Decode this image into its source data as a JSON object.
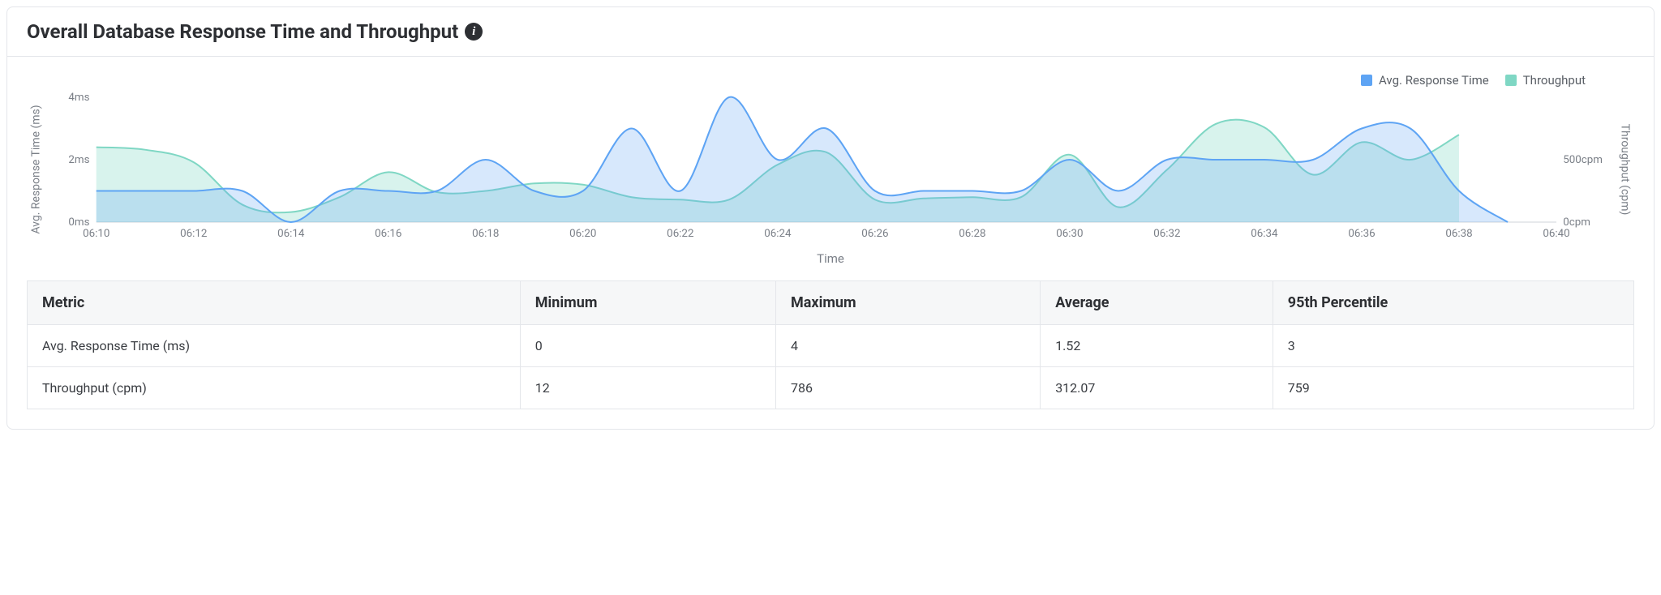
{
  "header": {
    "title": "Overall Database Response Time and Throughput",
    "info_glyph": "i"
  },
  "legend": {
    "series1": "Avg. Response Time",
    "series2": "Throughput",
    "color1": "#5ea4f4",
    "color2": "#7fd7c4"
  },
  "axis": {
    "y_left_label": "Avg. Response Time (ms)",
    "y_right_label": "Throughput (cpm)",
    "x_label": "Time"
  },
  "chart_data": {
    "type": "line",
    "x": [
      "06:10",
      "06:11",
      "06:12",
      "06:13",
      "06:14",
      "06:15",
      "06:16",
      "06:17",
      "06:18",
      "06:19",
      "06:20",
      "06:21",
      "06:22",
      "06:23",
      "06:24",
      "06:25",
      "06:26",
      "06:27",
      "06:28",
      "06:29",
      "06:30",
      "06:31",
      "06:32",
      "06:33",
      "06:34",
      "06:35",
      "06:36",
      "06:37",
      "06:38",
      "06:39",
      "06:40"
    ],
    "x_ticks": [
      "06:10",
      "06:12",
      "06:14",
      "06:16",
      "06:18",
      "06:20",
      "06:22",
      "06:24",
      "06:26",
      "06:28",
      "06:30",
      "06:32",
      "06:34",
      "06:36",
      "06:38",
      "06:40"
    ],
    "series": [
      {
        "name": "Avg. Response Time",
        "axis": "left",
        "color": "#5ea4f4",
        "fill": "rgba(94,164,244,0.25)",
        "values": [
          1,
          1,
          1,
          1,
          0,
          1,
          1,
          1,
          2,
          1,
          1,
          3,
          1,
          4,
          2,
          3,
          1,
          1,
          1,
          1,
          2,
          1,
          2,
          2,
          2,
          2,
          3,
          3,
          1,
          0,
          null
        ]
      },
      {
        "name": "Throughput",
        "axis": "right",
        "color": "#7fd7c4",
        "fill": "rgba(127,215,196,0.30)",
        "values": [
          600,
          580,
          480,
          140,
          80,
          200,
          400,
          240,
          250,
          310,
          300,
          200,
          180,
          180,
          460,
          560,
          180,
          190,
          200,
          200,
          540,
          120,
          420,
          786,
          759,
          380,
          640,
          500,
          700,
          null,
          null
        ]
      }
    ],
    "y_left": {
      "min": 0,
      "max": 4,
      "ticks": [
        0,
        2,
        4
      ],
      "tick_labels": [
        "0ms",
        "2ms",
        "4ms"
      ]
    },
    "y_right": {
      "min": 0,
      "max": 1000,
      "ticks": [
        0,
        500
      ],
      "tick_labels": [
        "0cpm",
        "500cpm"
      ]
    },
    "xlabel": "Time",
    "grid": false,
    "legend_position": "top-right"
  },
  "table": {
    "headers": [
      "Metric",
      "Minimum",
      "Maximum",
      "Average",
      "95th Percentile"
    ],
    "rows": [
      [
        "Avg. Response Time (ms)",
        "0",
        "4",
        "1.52",
        "3"
      ],
      [
        "Throughput (cpm)",
        "12",
        "786",
        "312.07",
        "759"
      ]
    ]
  }
}
